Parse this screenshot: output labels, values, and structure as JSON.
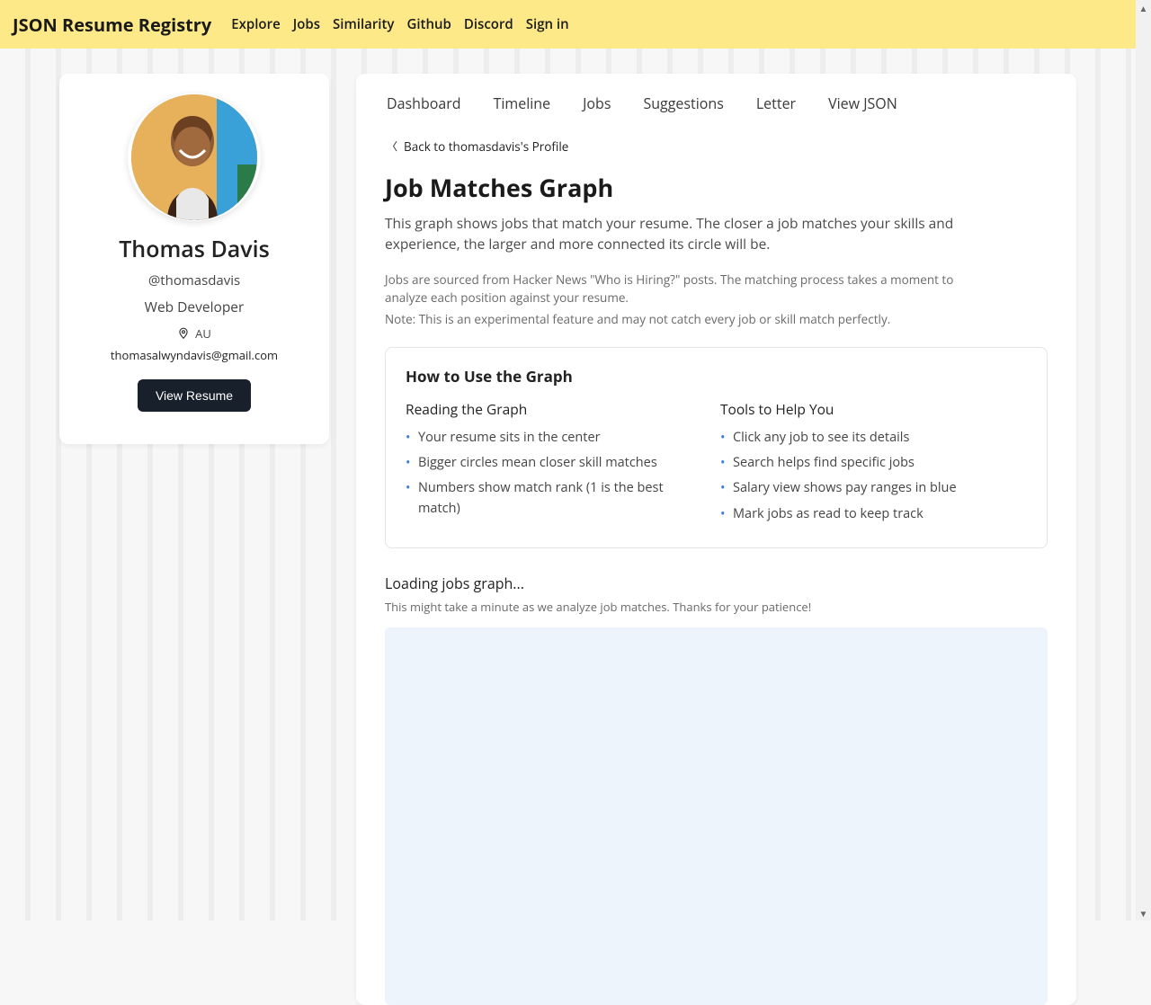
{
  "brand": "JSON Resume Registry",
  "topnav": [
    "Explore",
    "Jobs",
    "Similarity",
    "Github",
    "Discord",
    "Sign in"
  ],
  "profile": {
    "name": "Thomas Davis",
    "handle": "@thomasdavis",
    "role": "Web Developer",
    "location": "AU",
    "email": "thomasalwyndavis@gmail.com",
    "view_resume_label": "View Resume"
  },
  "subnav": [
    "Dashboard",
    "Timeline",
    "Jobs",
    "Suggestions",
    "Letter",
    "View JSON"
  ],
  "back_label": "Back to thomasdavis's Profile",
  "page_title": "Job Matches Graph",
  "intro": "This graph shows jobs that match your resume. The closer a job matches your skills and experience, the larger and more connected its circle will be.",
  "meta1": "Jobs are sourced from Hacker News \"Who is Hiring?\" posts. The matching process takes a moment to analyze each position against your resume.",
  "meta2": "Note: This is an experimental feature and may not catch every job or skill match perfectly.",
  "howto": {
    "title": "How to Use the Graph",
    "left_title": "Reading the Graph",
    "left_items": [
      "Your resume sits in the center",
      "Bigger circles mean closer skill matches",
      "Numbers show match rank (1 is the best match)"
    ],
    "right_title": "Tools to Help You",
    "right_items": [
      "Click any job to see its details",
      "Search helps find specific jobs",
      "Salary view shows pay ranges in blue",
      "Mark jobs as read to keep track"
    ]
  },
  "loading": {
    "title": "Loading jobs graph...",
    "sub": "This might take a minute as we analyze job matches. Thanks for your patience!"
  }
}
